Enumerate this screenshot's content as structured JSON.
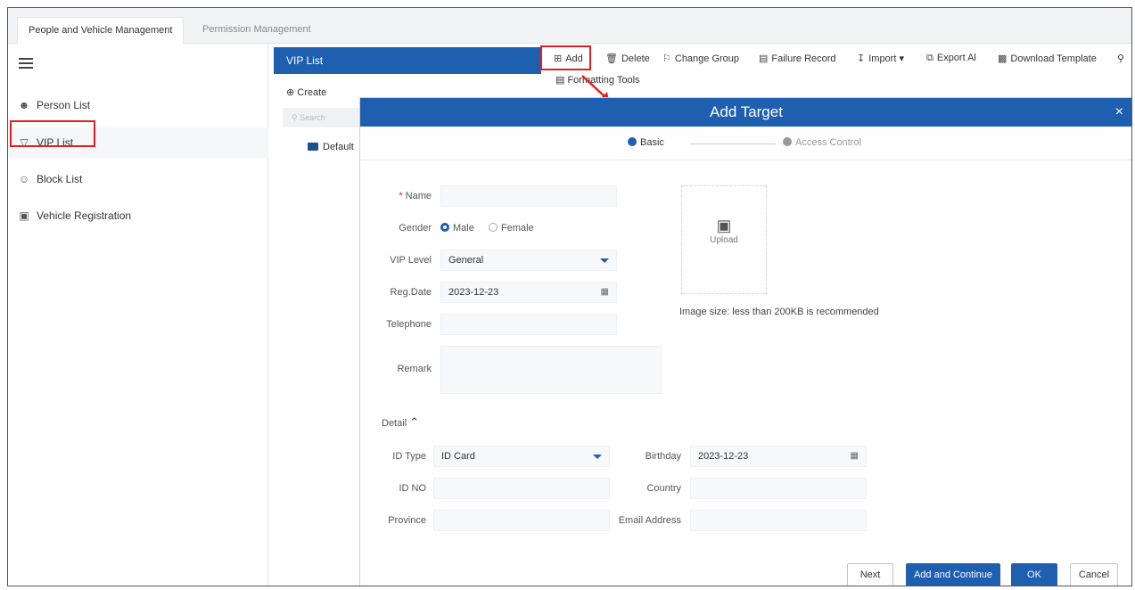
{
  "top_tabs": [
    "People and Vehicle Management",
    "Permission Management"
  ],
  "sidebar": {
    "items": [
      {
        "label": "Person List",
        "icon": "person-icon"
      },
      {
        "label": "VIP List",
        "icon": "shield-icon"
      },
      {
        "label": "Block List",
        "icon": "person-block-icon"
      },
      {
        "label": "Vehicle Registration",
        "icon": "car-icon"
      }
    ]
  },
  "middle": {
    "header": "VIP List",
    "create": "Create",
    "search_placeholder": "Search",
    "tree_default": "Default"
  },
  "toolbar": {
    "add": "Add",
    "delete": "Delete",
    "change_group": "Change Group",
    "failure_record": "Failure Record",
    "import": "Import",
    "export_all": "Export Al",
    "download_template": "Download Template",
    "formatting_tools": "Formatting Tools"
  },
  "dialog": {
    "title": "Add Target",
    "close": "×",
    "steps": [
      "Basic",
      "Access Control"
    ],
    "labels": {
      "name": "Name",
      "gender": "Gender",
      "male": "Male",
      "female": "Female",
      "vip_level": "VIP Level",
      "reg_date": "Reg.Date",
      "telephone": "Telephone",
      "remark": "Remark",
      "detail": "Detail",
      "id_type": "ID Type",
      "id_no": "ID NO",
      "province": "Province",
      "birthday": "Birthday",
      "country": "Country",
      "email": "Email Address"
    },
    "values": {
      "vip_level": "General",
      "reg_date": "2023-12-23",
      "id_type": "ID Card",
      "birthday": "2023-12-23"
    },
    "upload_label": "Upload",
    "image_note": "Image size: less than 200KB is recommended",
    "buttons": {
      "next": "Next",
      "add_continue": "Add and Continue",
      "ok": "OK",
      "cancel": "Cancel"
    }
  },
  "colors": {
    "accent": "#1e5fb0",
    "highlight": "#e02020"
  }
}
